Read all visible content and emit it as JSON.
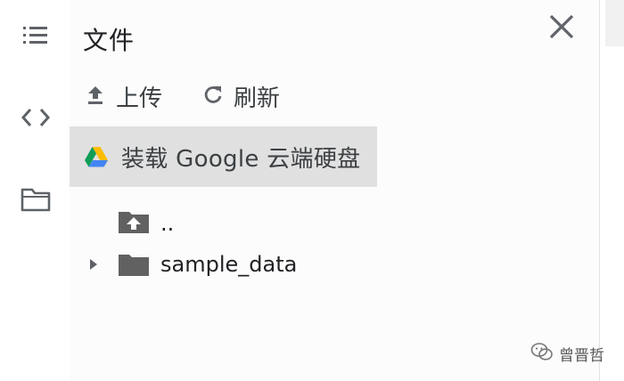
{
  "colors": {
    "icon": "#5f6368",
    "folder": "#616161",
    "accent_bg": "#e0e0e0"
  },
  "sidebar_rail": {
    "icons": [
      "list-icon",
      "code-icon",
      "folder-icon"
    ]
  },
  "panel": {
    "title": "文件",
    "actions": [
      {
        "label": "上传",
        "icon": "upload-icon"
      },
      {
        "label": "刷新",
        "icon": "refresh-icon"
      }
    ],
    "mount_drive": {
      "label": "装载 Google 云端硬盘",
      "icon": "google-drive-icon"
    }
  },
  "file_tree": {
    "parent": {
      "label": "..",
      "icon": "parent-folder-icon"
    },
    "items": [
      {
        "label": "sample_data",
        "icon": "folder-icon",
        "expand_icon": "caret-right-icon"
      }
    ]
  },
  "watermark": {
    "text": "曾晋哲"
  }
}
